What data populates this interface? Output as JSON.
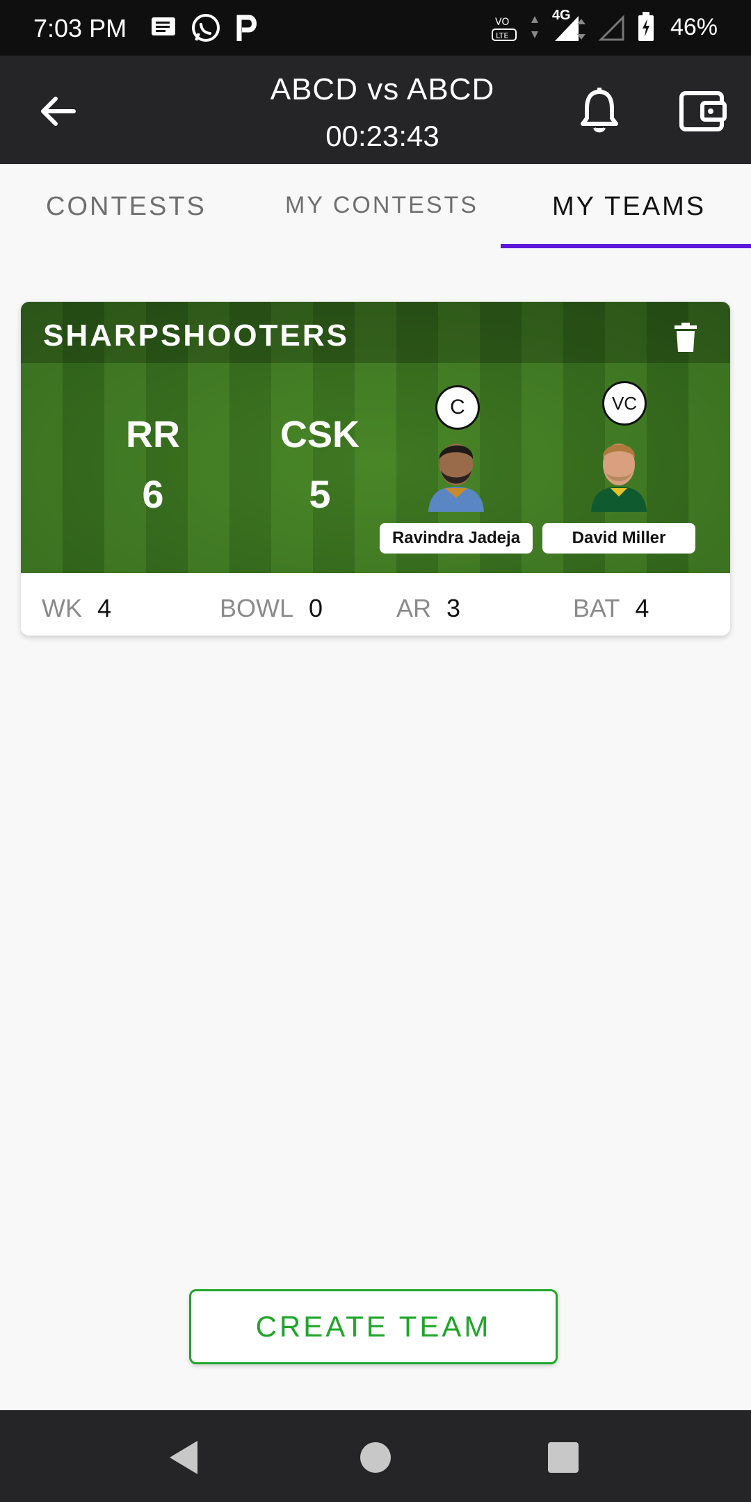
{
  "status_bar": {
    "time": "7:03 PM",
    "network": "4G",
    "battery": "46%"
  },
  "toolbar": {
    "title": "ABCD vs ABCD",
    "timer": "00:23:43"
  },
  "tabs": [
    {
      "label": "CONTESTS"
    },
    {
      "label": "MY CONTESTS"
    },
    {
      "label": "MY TEAMS",
      "active": true
    }
  ],
  "team_card": {
    "name": "SHARPSHOOTERS",
    "teams": [
      {
        "abbr": "RR",
        "count": "6"
      },
      {
        "abbr": "CSK",
        "count": "5"
      }
    ],
    "captain": {
      "badge": "C",
      "name": "Ravindra Jadeja"
    },
    "vice_captain": {
      "badge": "VC",
      "name": "David Miller"
    },
    "roles": [
      {
        "label": "WK",
        "value": "4"
      },
      {
        "label": "BOWL",
        "value": "0"
      },
      {
        "label": "AR",
        "value": "3"
      },
      {
        "label": "BAT",
        "value": "4"
      }
    ]
  },
  "create_button": {
    "label": "CREATE TEAM"
  },
  "colors": {
    "accent": "#5b16d8",
    "create_green": "#1fa52a",
    "toolbar_bg": "#252527"
  }
}
